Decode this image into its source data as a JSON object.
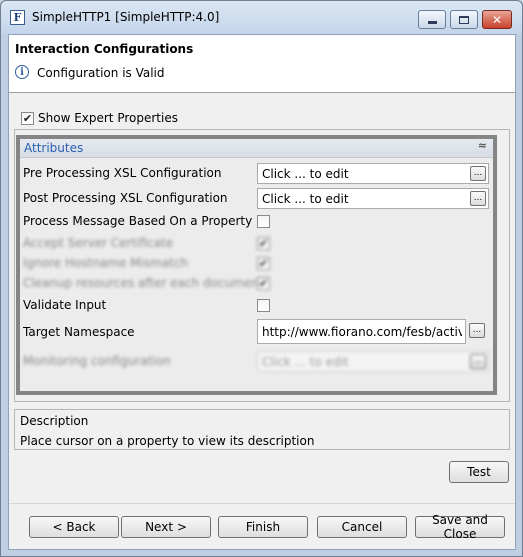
{
  "window": {
    "app_icon_glyph": "F",
    "title": "SimpleHTTP1 [SimpleHTTP:4.0]",
    "controls": {
      "minimize": "minimize-icon",
      "maximize": "maximize-icon",
      "close": "close-icon"
    }
  },
  "header": {
    "title": "Interaction Configurations",
    "status_icon_glyph": "i",
    "status": "Configuration is Valid"
  },
  "expert": {
    "label": "Show Expert Properties",
    "checked": true,
    "check_glyph": "✔"
  },
  "attributes": {
    "title": "Attributes",
    "collapse_glyph": "≈",
    "properties": [
      {
        "label": "Pre Processing XSL Configuration",
        "value": "Click ... to edit",
        "button": "..."
      },
      {
        "label": "Post Processing XSL Configuration",
        "value": "Click ... to edit",
        "button": "..."
      },
      {
        "label": "Process Message Based On a Property",
        "checked": false
      },
      {
        "label": "Accept Server Certificate",
        "checked": true,
        "check_glyph": "✔"
      },
      {
        "label": "Ignore Hostname Mismatch",
        "checked": true,
        "check_glyph": "✔"
      },
      {
        "label": "Cleanup resources after each document",
        "checked": true,
        "check_glyph": "✔"
      },
      {
        "label": "Validate Input",
        "checked": false
      },
      {
        "label": "Target Namespace",
        "value": "http://www.fiorano.com/fesb/activity",
        "button": "..."
      },
      {
        "label": "Monitoring configuration",
        "value": "Click ... to edit",
        "button": "..."
      }
    ]
  },
  "description": {
    "title": "Description",
    "text": "Place cursor on a property to view its description"
  },
  "buttons": {
    "test": "Test",
    "back": "< Back",
    "next": "Next >",
    "finish": "Finish",
    "cancel": "Cancel",
    "save_close": "Save and Close"
  }
}
